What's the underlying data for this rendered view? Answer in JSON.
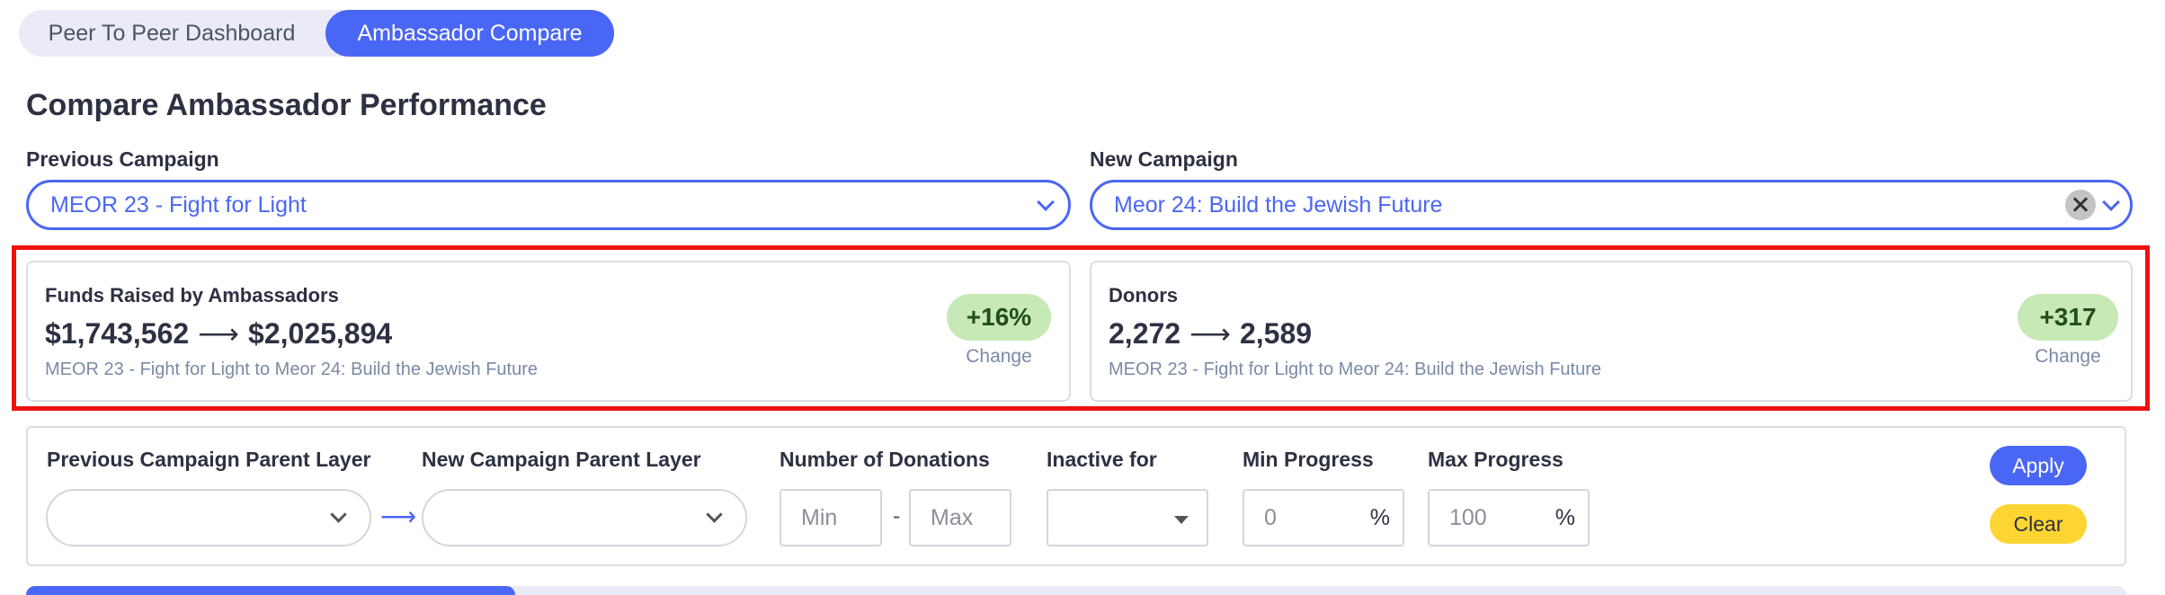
{
  "tabs": [
    {
      "label": "Peer To Peer Dashboard",
      "active": false
    },
    {
      "label": "Ambassador Compare",
      "active": true
    }
  ],
  "page_title": "Compare Ambassador Performance",
  "previous_campaign": {
    "label": "Previous Campaign",
    "value": "MEOR 23 - Fight for Light"
  },
  "new_campaign": {
    "label": "New Campaign",
    "value": "Meor 24: Build the Jewish Future"
  },
  "cards": {
    "funds": {
      "title": "Funds Raised by Ambassadors",
      "from": "$1,743,562",
      "to": "$2,025,894",
      "subtitle": "MEOR 23 - Fight for Light to Meor 24: Build the Jewish Future",
      "change": "+16%",
      "change_label": "Change"
    },
    "donors": {
      "title": "Donors",
      "from": "2,272",
      "to": "2,589",
      "subtitle": "MEOR 23 - Fight for Light to Meor 24: Build the Jewish Future",
      "change": "+317",
      "change_label": "Change"
    },
    "arrow": "⟶"
  },
  "filters": {
    "prev_parent_label": "Previous Campaign Parent Layer",
    "new_parent_label": "New Campaign Parent Layer",
    "flow_arrow": "⟶",
    "donations_label": "Number of Donations",
    "min_placeholder": "Min",
    "range_separator": "-",
    "max_placeholder": "Max",
    "inactive_label": "Inactive for",
    "min_progress_label": "Min Progress",
    "min_progress_placeholder": "0",
    "max_progress_label": "Max Progress",
    "max_progress_placeholder": "100",
    "percent": "%",
    "apply": "Apply",
    "clear": "Clear"
  },
  "bottom_bar": {
    "fill_fraction": 0.233
  },
  "colors": {
    "accent": "#4a66f5",
    "badge_bg": "#c7e9b6",
    "clear_btn": "#fcd532",
    "highlight": "#ee1111"
  }
}
